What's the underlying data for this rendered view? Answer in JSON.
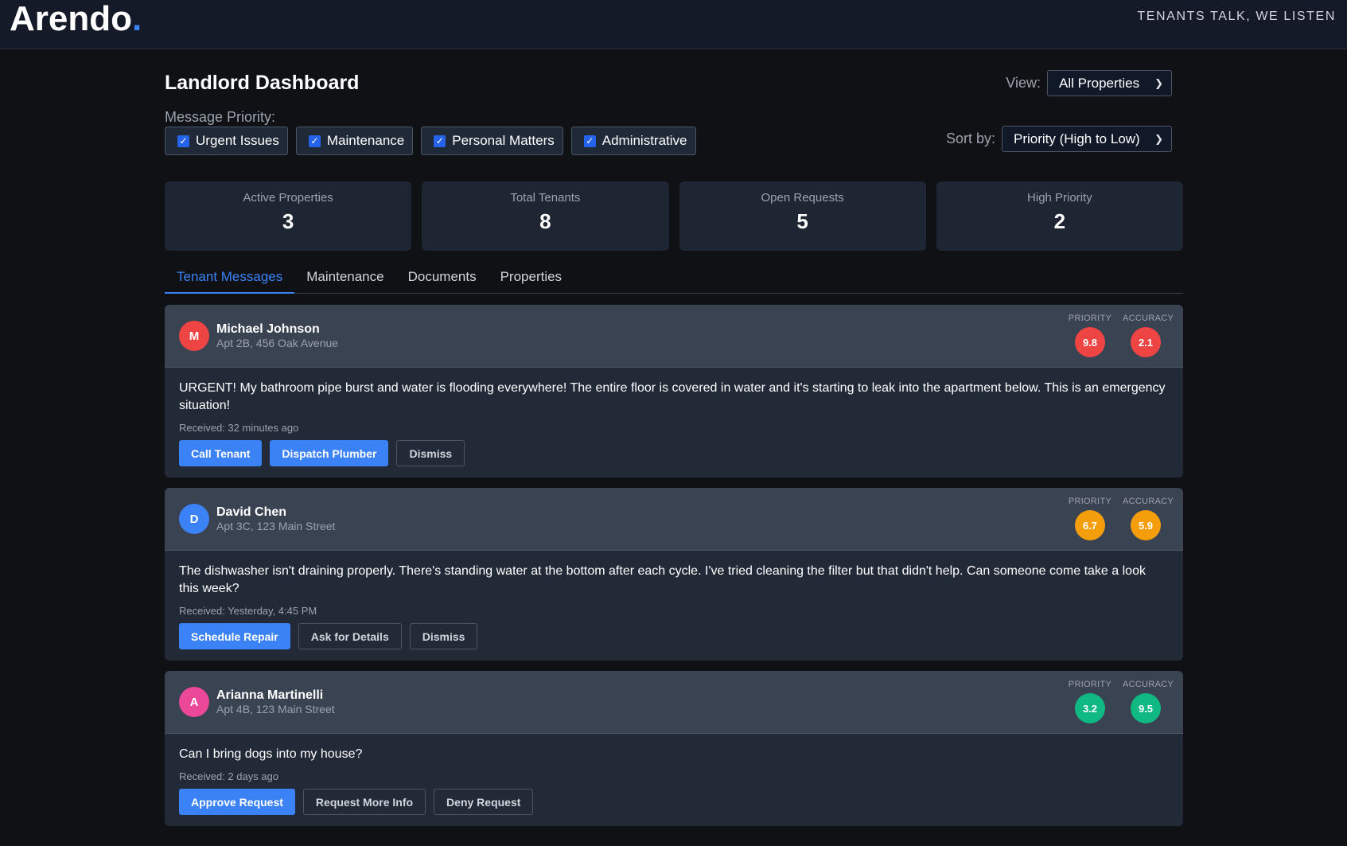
{
  "header": {
    "logo_text": "Arendo",
    "logo_dot": ".",
    "tagline": "TENANTS TALK, WE LISTEN"
  },
  "page": {
    "title": "Landlord Dashboard",
    "view_label": "View:",
    "view_value": "All Properties",
    "sort_label": "Sort by:",
    "sort_value": "Priority (High to Low)",
    "priority_label": "Message Priority:"
  },
  "filters": [
    {
      "label": "Urgent Issues",
      "checked": true
    },
    {
      "label": "Maintenance",
      "checked": true
    },
    {
      "label": "Personal Matters",
      "checked": true
    },
    {
      "label": "Administrative",
      "checked": true
    }
  ],
  "stats": [
    {
      "label": "Active Properties",
      "value": "3"
    },
    {
      "label": "Total Tenants",
      "value": "8"
    },
    {
      "label": "Open Requests",
      "value": "5"
    },
    {
      "label": "High Priority",
      "value": "2"
    }
  ],
  "tabs": [
    {
      "label": "Tenant Messages",
      "active": true
    },
    {
      "label": "Maintenance",
      "active": false
    },
    {
      "label": "Documents",
      "active": false
    },
    {
      "label": "Properties",
      "active": false
    }
  ],
  "score_labels": {
    "priority": "PRIORITY",
    "accuracy": "ACCURACY"
  },
  "messages": [
    {
      "initial": "M",
      "avatar_color": "#ef4444",
      "name": "Michael Johnson",
      "address": "Apt 2B, 456 Oak Avenue",
      "priority": "9.8",
      "accuracy": "2.1",
      "priority_color": "#ef4444",
      "accuracy_color": "#ef4444",
      "text": "URGENT! My bathroom pipe burst and water is flooding everywhere! The entire floor is covered in water and it's starting to leak into the apartment below. This is an emergency situation!",
      "received": "Received: 32 minutes ago",
      "actions": [
        {
          "label": "Call Tenant",
          "style": "primary"
        },
        {
          "label": "Dispatch Plumber",
          "style": "primary"
        },
        {
          "label": "Dismiss",
          "style": "ghost"
        }
      ]
    },
    {
      "initial": "D",
      "avatar_color": "#3b82f6",
      "name": "David Chen",
      "address": "Apt 3C, 123 Main Street",
      "priority": "6.7",
      "accuracy": "5.9",
      "priority_color": "#f59e0b",
      "accuracy_color": "#f59e0b",
      "text": "The dishwasher isn't draining properly. There's standing water at the bottom after each cycle. I've tried cleaning the filter but that didn't help. Can someone come take a look this week?",
      "received": "Received: Yesterday, 4:45 PM",
      "actions": [
        {
          "label": "Schedule Repair",
          "style": "primary"
        },
        {
          "label": "Ask for Details",
          "style": "ghost"
        },
        {
          "label": "Dismiss",
          "style": "ghost"
        }
      ]
    },
    {
      "initial": "A",
      "avatar_color": "#ec4899",
      "name": "Arianna Martinelli",
      "address": "Apt 4B, 123 Main Street",
      "priority": "3.2",
      "accuracy": "9.5",
      "priority_color": "#10b981",
      "accuracy_color": "#10b981",
      "text": "Can I bring dogs into my house?",
      "received": "Received: 2 days ago",
      "actions": [
        {
          "label": "Approve Request",
          "style": "primary"
        },
        {
          "label": "Request More Info",
          "style": "ghost"
        },
        {
          "label": "Deny Request",
          "style": "ghost"
        }
      ]
    }
  ]
}
